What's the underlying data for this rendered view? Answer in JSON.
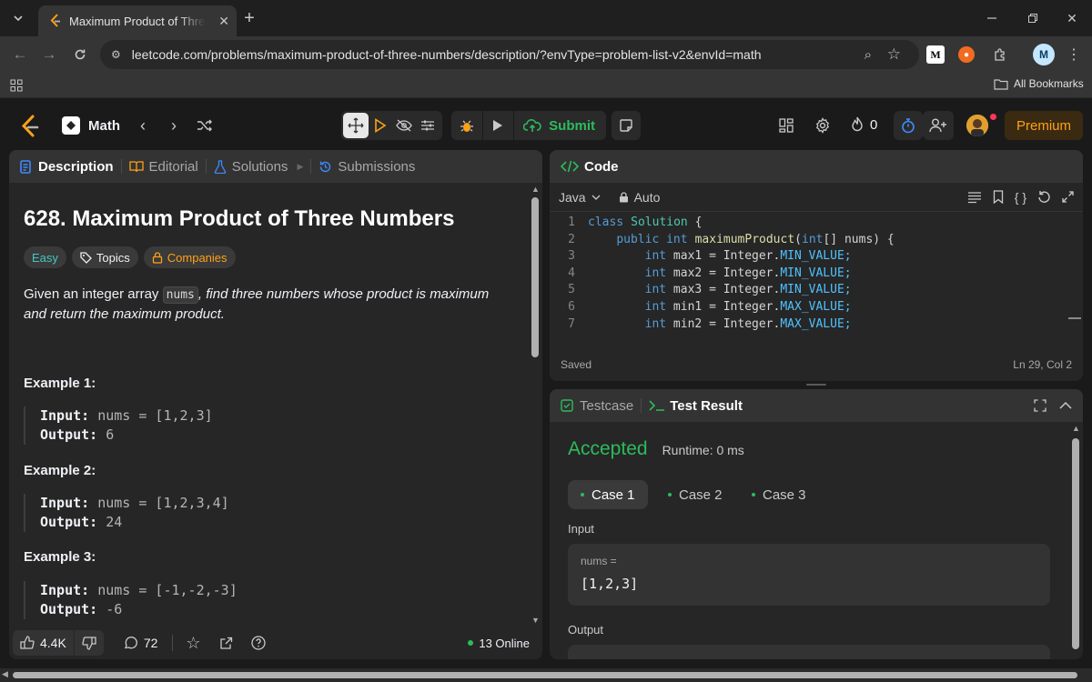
{
  "browser": {
    "tab_title": "Maximum Product of Three Nu",
    "url": "leetcode.com/problems/maximum-product-of-three-numbers/description/?envType=problem-list-v2&envId=math",
    "all_bookmarks": "All Bookmarks",
    "profile_letter": "M",
    "ext_letter": "M"
  },
  "nav": {
    "problem_list": "Math",
    "submit": "Submit",
    "streak": "0",
    "premium": "Premium"
  },
  "description": {
    "tabs": {
      "description": "Description",
      "editorial": "Editorial",
      "solutions": "Solutions",
      "submissions": "Submissions"
    },
    "title": "628. Maximum Product of Three Numbers",
    "badges": {
      "difficulty": "Easy",
      "topics": "Topics",
      "companies": "Companies"
    },
    "text_before": "Given an integer array ",
    "text_code": "nums",
    "text_after": ", find three numbers whose product is maximum and return the maximum product.",
    "input_label": "Input:",
    "output_label": "Output:",
    "examples": [
      {
        "title": "Example 1:",
        "input": "nums = [1,2,3]",
        "output": "6"
      },
      {
        "title": "Example 2:",
        "input": "nums = [1,2,3,4]",
        "output": "24"
      },
      {
        "title": "Example 3:",
        "input": "nums = [-1,-2,-3]",
        "output": "-6"
      }
    ],
    "footer": {
      "likes": "4.4K",
      "comments": "72",
      "online": "13 Online"
    }
  },
  "code": {
    "header": "Code",
    "language": "Java",
    "mode": "Auto",
    "saved": "Saved",
    "cursor": "Ln 29, Col 2",
    "lines": [
      {
        "n": "1",
        "indent": "",
        "a": "class",
        "b": "Solution",
        "c": " {"
      },
      {
        "n": "2",
        "indent": "    ",
        "a": "public int",
        "b": "maximumProduct",
        "c": "(int[] nums) {"
      },
      {
        "n": "3",
        "indent": "        ",
        "a": "int",
        "b": " max1 = Integer.",
        "c": "MIN_VALUE;"
      },
      {
        "n": "4",
        "indent": "        ",
        "a": "int",
        "b": " max2 = Integer.",
        "c": "MIN_VALUE;"
      },
      {
        "n": "5",
        "indent": "        ",
        "a": "int",
        "b": " max3 = Integer.",
        "c": "MIN_VALUE;"
      },
      {
        "n": "6",
        "indent": "        ",
        "a": "int",
        "b": " min1 = Integer.",
        "c": "MAX_VALUE;"
      },
      {
        "n": "7",
        "indent": "        ",
        "a": "int",
        "b": " min2 = Integer.",
        "c": "MAX_VALUE;"
      }
    ]
  },
  "result": {
    "tabs": {
      "testcase": "Testcase",
      "test_result": "Test Result"
    },
    "status": "Accepted",
    "runtime": "Runtime: 0 ms",
    "cases": [
      "Case 1",
      "Case 2",
      "Case 3"
    ],
    "input_label": "Input",
    "var_name": "nums =",
    "var_value": "[1,2,3]",
    "output_label": "Output"
  },
  "colors": {
    "accent_green": "#2cbb5d",
    "premium_orange": "#ffa116",
    "link_blue": "#3e8bff"
  }
}
